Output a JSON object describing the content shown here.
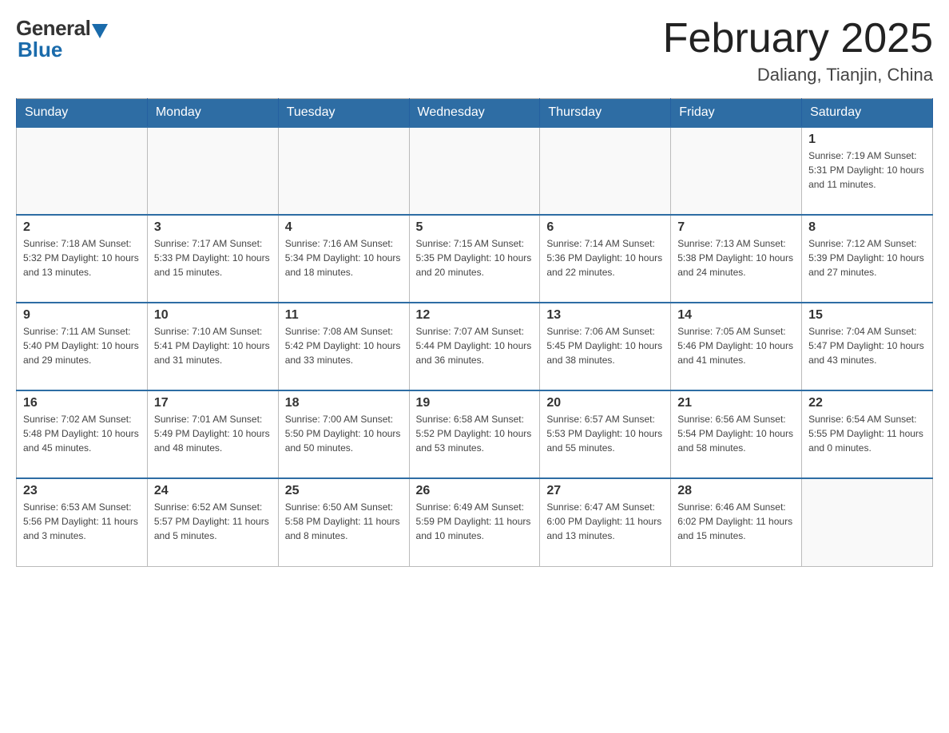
{
  "header": {
    "logo_general": "General",
    "logo_blue": "Blue",
    "month_title": "February 2025",
    "location": "Daliang, Tianjin, China"
  },
  "days_of_week": [
    "Sunday",
    "Monday",
    "Tuesday",
    "Wednesday",
    "Thursday",
    "Friday",
    "Saturday"
  ],
  "weeks": [
    [
      {
        "day": "",
        "info": ""
      },
      {
        "day": "",
        "info": ""
      },
      {
        "day": "",
        "info": ""
      },
      {
        "day": "",
        "info": ""
      },
      {
        "day": "",
        "info": ""
      },
      {
        "day": "",
        "info": ""
      },
      {
        "day": "1",
        "info": "Sunrise: 7:19 AM\nSunset: 5:31 PM\nDaylight: 10 hours and 11 minutes."
      }
    ],
    [
      {
        "day": "2",
        "info": "Sunrise: 7:18 AM\nSunset: 5:32 PM\nDaylight: 10 hours and 13 minutes."
      },
      {
        "day": "3",
        "info": "Sunrise: 7:17 AM\nSunset: 5:33 PM\nDaylight: 10 hours and 15 minutes."
      },
      {
        "day": "4",
        "info": "Sunrise: 7:16 AM\nSunset: 5:34 PM\nDaylight: 10 hours and 18 minutes."
      },
      {
        "day": "5",
        "info": "Sunrise: 7:15 AM\nSunset: 5:35 PM\nDaylight: 10 hours and 20 minutes."
      },
      {
        "day": "6",
        "info": "Sunrise: 7:14 AM\nSunset: 5:36 PM\nDaylight: 10 hours and 22 minutes."
      },
      {
        "day": "7",
        "info": "Sunrise: 7:13 AM\nSunset: 5:38 PM\nDaylight: 10 hours and 24 minutes."
      },
      {
        "day": "8",
        "info": "Sunrise: 7:12 AM\nSunset: 5:39 PM\nDaylight: 10 hours and 27 minutes."
      }
    ],
    [
      {
        "day": "9",
        "info": "Sunrise: 7:11 AM\nSunset: 5:40 PM\nDaylight: 10 hours and 29 minutes."
      },
      {
        "day": "10",
        "info": "Sunrise: 7:10 AM\nSunset: 5:41 PM\nDaylight: 10 hours and 31 minutes."
      },
      {
        "day": "11",
        "info": "Sunrise: 7:08 AM\nSunset: 5:42 PM\nDaylight: 10 hours and 33 minutes."
      },
      {
        "day": "12",
        "info": "Sunrise: 7:07 AM\nSunset: 5:44 PM\nDaylight: 10 hours and 36 minutes."
      },
      {
        "day": "13",
        "info": "Sunrise: 7:06 AM\nSunset: 5:45 PM\nDaylight: 10 hours and 38 minutes."
      },
      {
        "day": "14",
        "info": "Sunrise: 7:05 AM\nSunset: 5:46 PM\nDaylight: 10 hours and 41 minutes."
      },
      {
        "day": "15",
        "info": "Sunrise: 7:04 AM\nSunset: 5:47 PM\nDaylight: 10 hours and 43 minutes."
      }
    ],
    [
      {
        "day": "16",
        "info": "Sunrise: 7:02 AM\nSunset: 5:48 PM\nDaylight: 10 hours and 45 minutes."
      },
      {
        "day": "17",
        "info": "Sunrise: 7:01 AM\nSunset: 5:49 PM\nDaylight: 10 hours and 48 minutes."
      },
      {
        "day": "18",
        "info": "Sunrise: 7:00 AM\nSunset: 5:50 PM\nDaylight: 10 hours and 50 minutes."
      },
      {
        "day": "19",
        "info": "Sunrise: 6:58 AM\nSunset: 5:52 PM\nDaylight: 10 hours and 53 minutes."
      },
      {
        "day": "20",
        "info": "Sunrise: 6:57 AM\nSunset: 5:53 PM\nDaylight: 10 hours and 55 minutes."
      },
      {
        "day": "21",
        "info": "Sunrise: 6:56 AM\nSunset: 5:54 PM\nDaylight: 10 hours and 58 minutes."
      },
      {
        "day": "22",
        "info": "Sunrise: 6:54 AM\nSunset: 5:55 PM\nDaylight: 11 hours and 0 minutes."
      }
    ],
    [
      {
        "day": "23",
        "info": "Sunrise: 6:53 AM\nSunset: 5:56 PM\nDaylight: 11 hours and 3 minutes."
      },
      {
        "day": "24",
        "info": "Sunrise: 6:52 AM\nSunset: 5:57 PM\nDaylight: 11 hours and 5 minutes."
      },
      {
        "day": "25",
        "info": "Sunrise: 6:50 AM\nSunset: 5:58 PM\nDaylight: 11 hours and 8 minutes."
      },
      {
        "day": "26",
        "info": "Sunrise: 6:49 AM\nSunset: 5:59 PM\nDaylight: 11 hours and 10 minutes."
      },
      {
        "day": "27",
        "info": "Sunrise: 6:47 AM\nSunset: 6:00 PM\nDaylight: 11 hours and 13 minutes."
      },
      {
        "day": "28",
        "info": "Sunrise: 6:46 AM\nSunset: 6:02 PM\nDaylight: 11 hours and 15 minutes."
      },
      {
        "day": "",
        "info": ""
      }
    ]
  ]
}
